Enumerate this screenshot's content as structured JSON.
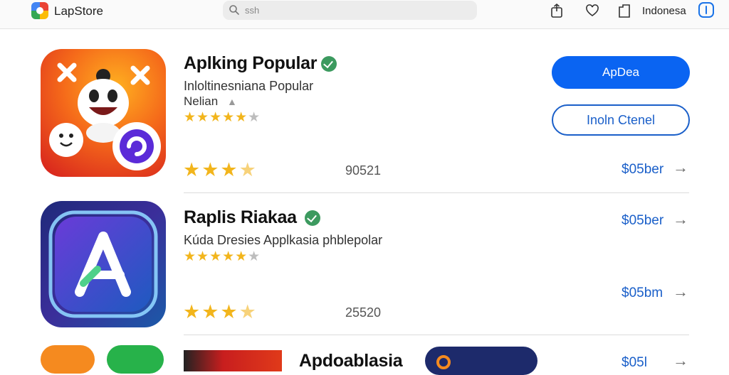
{
  "header": {
    "brand": "LapStore",
    "search_placeholder": "ssh",
    "region": "Indonesa"
  },
  "apps": [
    {
      "title": "Aplking Popular",
      "subtitle": "Inloltinesniana Popular",
      "publisher": "Nelian",
      "rating_stars": 4,
      "rating_count": "90521",
      "price": "$05ber",
      "primary_button": "ApDea",
      "secondary_button": "Inoln Ctenel"
    },
    {
      "title": "Raplis Riakaa",
      "subtitle": "Kúda Dresies Applkasia phblepolar",
      "rating_stars": 4,
      "rating_count": "25520",
      "price_top": "$05ber",
      "price_bottom": "$05bm"
    },
    {
      "title": "Apdoablasia",
      "price": "$05l"
    }
  ],
  "colors": {
    "accent": "#0a64f2",
    "link": "#1a5fc9",
    "star": "#f2b51c",
    "verified": "#3c9a5f"
  }
}
